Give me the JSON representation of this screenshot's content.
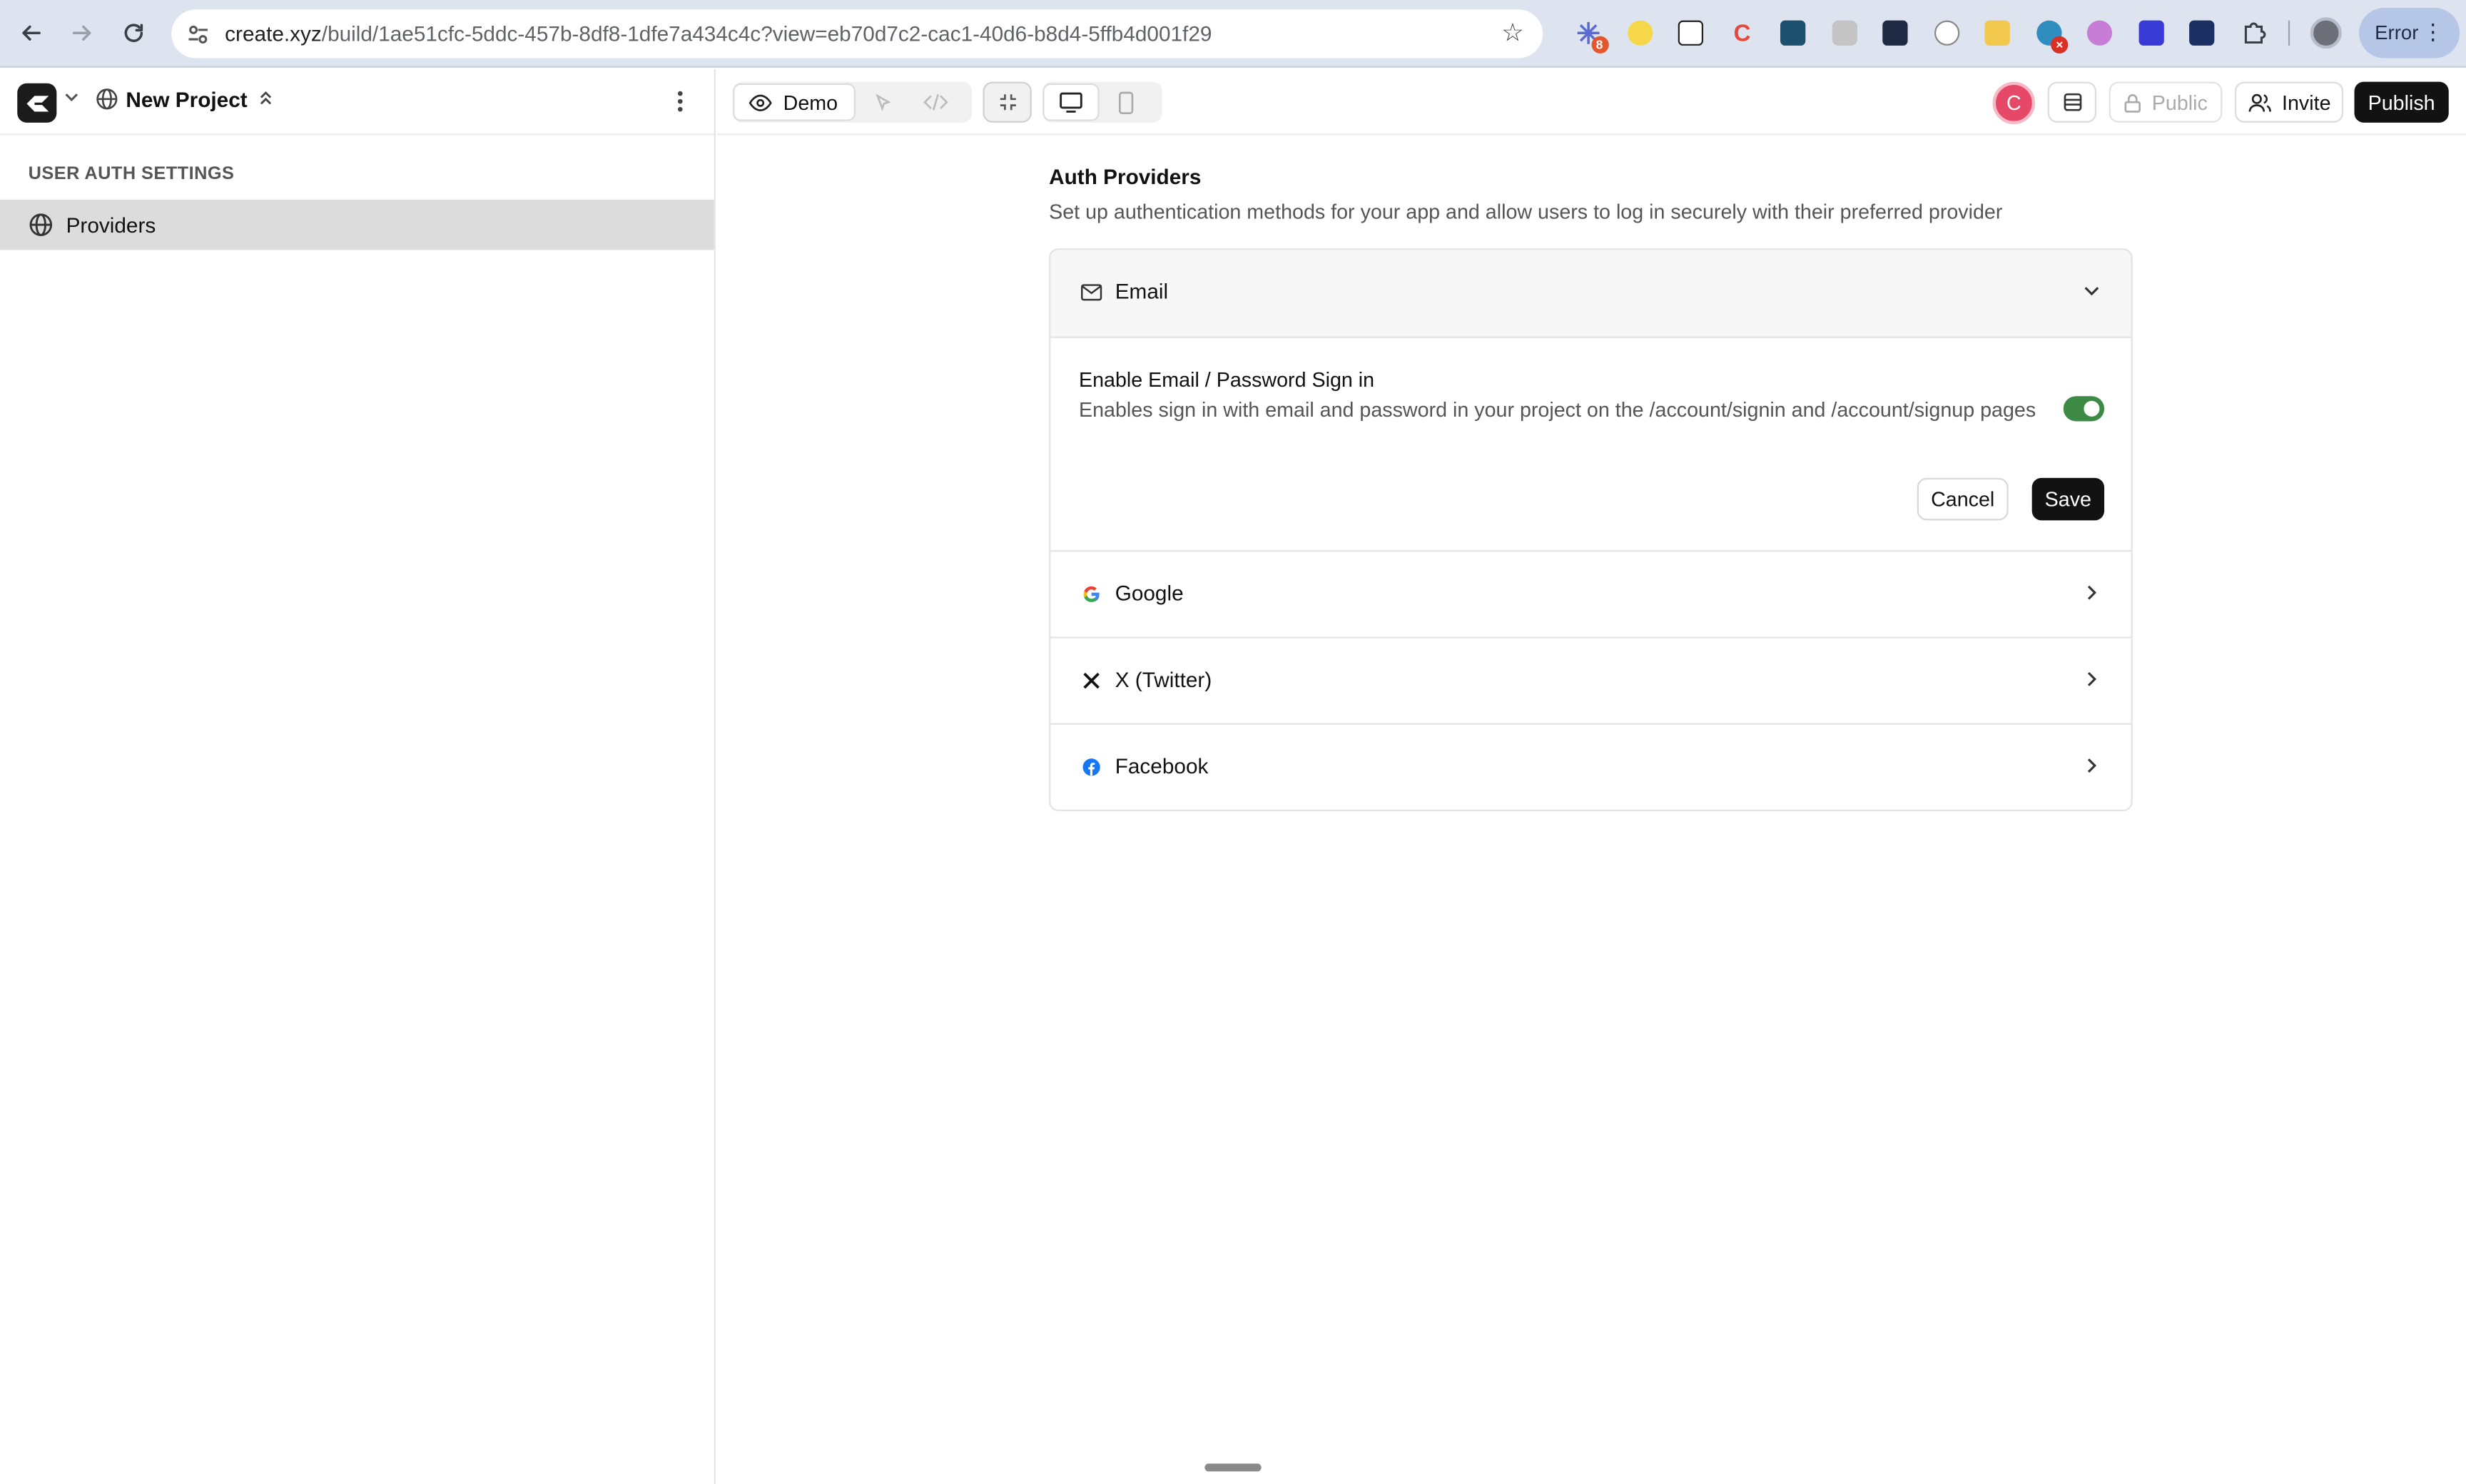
{
  "browser": {
    "url_host": "create.xyz",
    "url_path": "/build/1ae51cfc-5ddc-457b-8df8-1dfe7a434c4c?view=eb70d7c2-cac1-40d6-b8d4-5ffb4d001f29",
    "extension_badge_count": "8",
    "profile_status": "Error"
  },
  "sidebar": {
    "project_name": "New Project",
    "section_heading": "USER AUTH SETTINGS",
    "items": [
      {
        "label": "Providers",
        "icon": "globe-icon",
        "selected": true
      }
    ]
  },
  "toolbar": {
    "demo_label": "Demo",
    "public_label": "Public",
    "invite_label": "Invite",
    "publish_label": "Publish",
    "avatar_initial": "C",
    "avatar_color": "#e64967"
  },
  "main": {
    "title": "Auth Providers",
    "subtitle": "Set up authentication methods for your app and allow users to log in securely with their preferred provider",
    "providers": [
      {
        "name": "Email",
        "icon": "mail-icon",
        "expanded": true
      },
      {
        "name": "Google",
        "icon": "google-icon",
        "expanded": false
      },
      {
        "name": "X (Twitter)",
        "icon": "x-icon",
        "expanded": false
      },
      {
        "name": "Facebook",
        "icon": "facebook-icon",
        "expanded": false
      }
    ],
    "email_settings": {
      "title": "Enable Email / Password Sign in",
      "description": "Enables sign in with email and password in your project on the /account/signin and /account/signup pages",
      "enabled": true,
      "toggle_color": "#3d8a45",
      "cancel_label": "Cancel",
      "save_label": "Save"
    }
  }
}
